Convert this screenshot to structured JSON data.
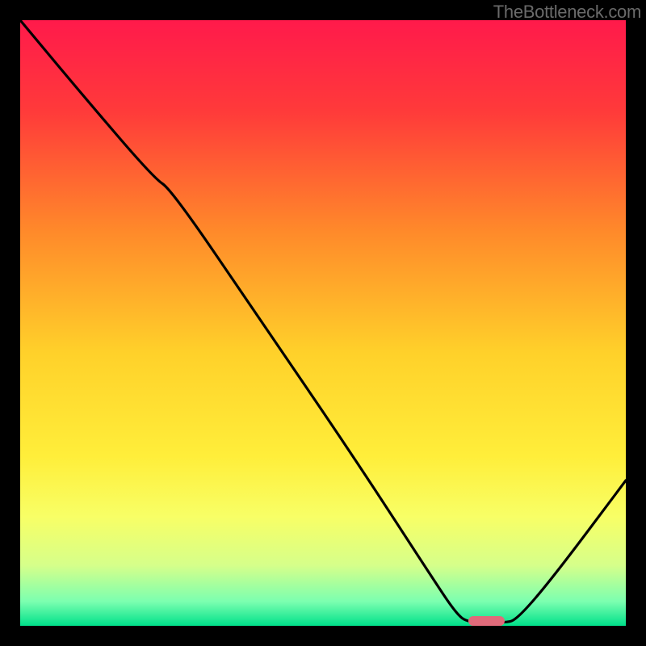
{
  "watermark": "TheBottleneck.com",
  "chart_data": {
    "type": "line",
    "title": "",
    "xlabel": "",
    "ylabel": "",
    "xlim": [
      0,
      100
    ],
    "ylim": [
      0,
      100
    ],
    "background_gradient": {
      "stops": [
        {
          "offset": 0.0,
          "color": "#ff1a4b"
        },
        {
          "offset": 0.15,
          "color": "#ff3a3a"
        },
        {
          "offset": 0.35,
          "color": "#ff8a2a"
        },
        {
          "offset": 0.55,
          "color": "#ffd12a"
        },
        {
          "offset": 0.72,
          "color": "#ffee3a"
        },
        {
          "offset": 0.82,
          "color": "#f8ff66"
        },
        {
          "offset": 0.9,
          "color": "#d6ff8a"
        },
        {
          "offset": 0.96,
          "color": "#7bffb0"
        },
        {
          "offset": 1.0,
          "color": "#00e08a"
        }
      ]
    },
    "series": [
      {
        "name": "bottleneck-curve",
        "x": [
          0,
          10,
          22,
          25,
          40,
          55,
          68,
          72,
          74,
          80,
          82,
          88,
          100
        ],
        "y": [
          100,
          88,
          74,
          72,
          50,
          28,
          8,
          2,
          0.5,
          0.5,
          1,
          8,
          24
        ]
      }
    ],
    "marker": {
      "name": "optimal-range",
      "x_start": 74,
      "x_end": 80,
      "y": 0.8,
      "color": "#e06a7a"
    }
  }
}
